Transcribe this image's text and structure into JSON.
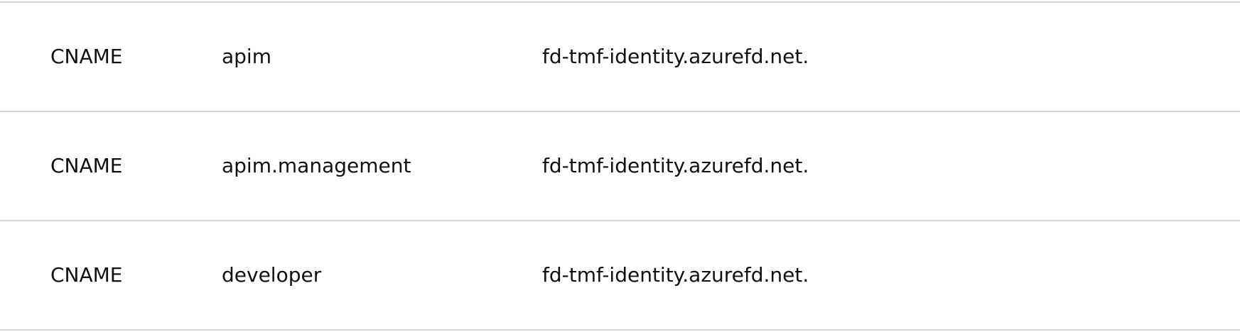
{
  "records": [
    {
      "type": "CNAME",
      "name": "apim",
      "value": "fd-tmf-identity.azurefd.net."
    },
    {
      "type": "CNAME",
      "name": "apim.management",
      "value": "fd-tmf-identity.azurefd.net."
    },
    {
      "type": "CNAME",
      "name": "developer",
      "value": "fd-tmf-identity.azurefd.net."
    }
  ]
}
